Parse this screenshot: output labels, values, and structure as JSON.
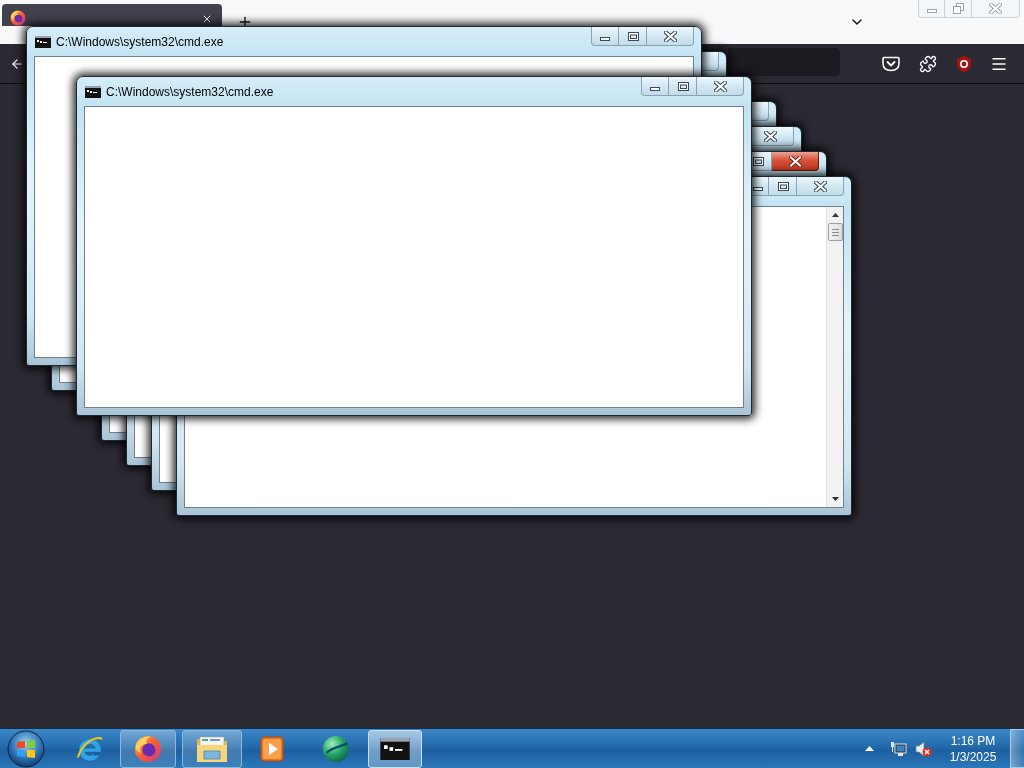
{
  "browser": {
    "tabs": [
      {
        "selected": true
      }
    ]
  },
  "cmd_windows": [
    {
      "buttons": [
        {
          "kind": "close",
          "highlighted": false
        }
      ]
    },
    {
      "buttons": [
        {
          "kind": "close",
          "highlighted": false
        }
      ]
    },
    {
      "buttons": [
        {
          "kind": "close",
          "highlighted": false
        }
      ]
    },
    {
      "buttons": [
        {
          "kind": "maximize",
          "highlighted": false
        },
        {
          "kind": "close",
          "highlighted": true
        }
      ]
    },
    {
      "buttons": [
        {
          "kind": "minimize",
          "highlighted": false
        },
        {
          "kind": "maximize",
          "highlighted": false
        },
        {
          "kind": "close",
          "highlighted": false
        }
      ],
      "scrollbar": true
    },
    {
      "title": "C:\\Windows\\system32\\cmd.exe",
      "buttons": [
        {
          "kind": "minimize",
          "highlighted": false
        },
        {
          "kind": "maximize",
          "highlighted": false
        },
        {
          "kind": "close",
          "highlighted": false
        }
      ]
    },
    {
      "title": "C:\\Windows\\system32\\cmd.exe",
      "buttons": [
        {
          "kind": "minimize",
          "highlighted": false
        },
        {
          "kind": "maximize",
          "highlighted": false
        },
        {
          "kind": "close",
          "highlighted": false
        }
      ]
    }
  ],
  "taskbar": {
    "items": [
      {
        "running": false,
        "selected": false
      },
      {
        "running": true,
        "selected": false
      },
      {
        "running": true,
        "selected": false
      },
      {
        "running": false,
        "selected": false
      },
      {
        "running": false,
        "selected": false
      },
      {
        "running": true,
        "selected": true
      }
    ],
    "clock": {
      "time": "1:16 PM",
      "date": "1/3/2025"
    }
  }
}
